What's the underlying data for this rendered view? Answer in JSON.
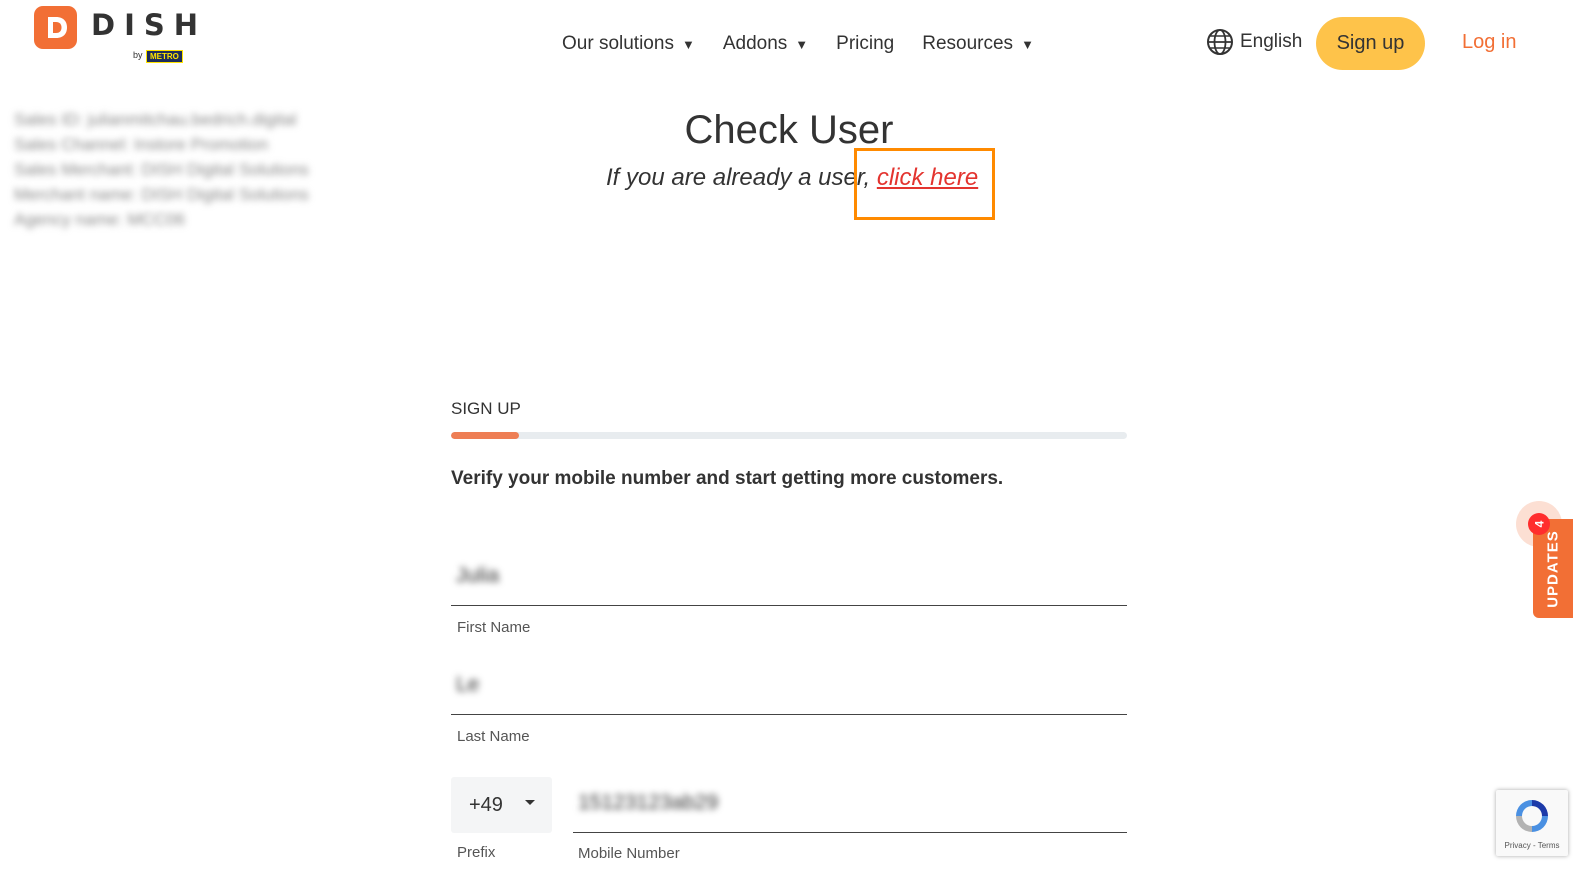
{
  "brand": {
    "name": "DISH",
    "by": "by",
    "partner": "METRO",
    "colors": {
      "primary": "#f26f35",
      "accent": "#fec34a",
      "link": "#e3342f",
      "highlight": "#ff8a00"
    }
  },
  "nav": {
    "items": [
      {
        "label": "Our solutions",
        "has_dropdown": true
      },
      {
        "label": "Addons",
        "has_dropdown": true
      },
      {
        "label": "Pricing",
        "has_dropdown": false
      },
      {
        "label": "Resources",
        "has_dropdown": true
      }
    ],
    "caret": "▼"
  },
  "header": {
    "language_icon": "globe-icon",
    "language": "English",
    "signup_label": "Sign up",
    "login_label": "Log in"
  },
  "sales_info": {
    "lines": [
      "Sales ID: julianmitchau.bedrich.digital",
      "Sales Channel: Instore Promotion",
      "Sales Merchant: DISH Digital Solutions",
      "Merchant name: DISH Digital Solutions",
      "Agency name: MCC06"
    ]
  },
  "check_user": {
    "title": "Check User",
    "subtitle_prefix": "If you are already a user,",
    "link_label": "click here"
  },
  "signup": {
    "section_label": "SIGN UP",
    "progress": 0.1,
    "headline": "Verify your mobile number and start getting more customers.",
    "first_name": {
      "value": "Julia",
      "label": "First Name"
    },
    "last_name": {
      "value": "Le",
      "label": "Last Name"
    },
    "prefix": {
      "value": "+49",
      "label": "Prefix"
    },
    "mobile": {
      "value": "15123123ab29",
      "label": "Mobile Number"
    }
  },
  "updates": {
    "label": "UPDATES",
    "count": "4"
  },
  "recaptcha": {
    "icon": "recaptcha-icon",
    "links": "Privacy - Terms"
  }
}
